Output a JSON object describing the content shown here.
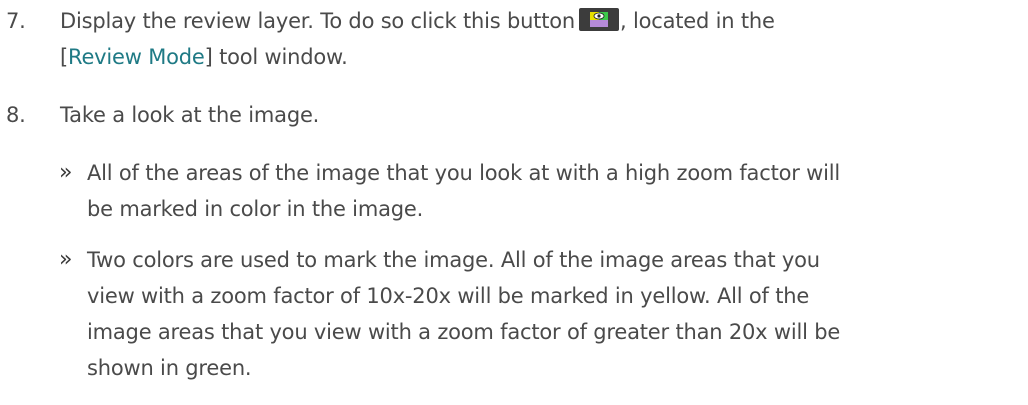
{
  "step7": {
    "number": "7.",
    "line1_before": "Display the review layer. To do so click this button",
    "button_icon": "review-layer-icon",
    "line1_after": ", located in the",
    "line2_open": "[",
    "line2_link": "Review Mode",
    "line2_close": "] tool window."
  },
  "step8": {
    "number": "8.",
    "text": "Take a look at the image."
  },
  "bullets": [
    {
      "mark": "»",
      "lines": [
        "All of the areas of the image that you look at with a high zoom factor will",
        "be marked in color in the image."
      ]
    },
    {
      "mark": "»",
      "lines": [
        "Two colors are used to mark the image. All of the image areas that you",
        "view with a zoom factor of 10x-20x will be marked in yellow. All of the",
        "image areas that you view with a zoom factor of greater than 20x will be",
        "shown in green."
      ]
    }
  ],
  "colors": {
    "text": "#4a4a4a",
    "link": "#1f7a85",
    "button_bg": "#3c3c3c",
    "icon_yellow": "#e8e000",
    "icon_green": "#3cc84a",
    "icon_purple": "#b58ad8"
  }
}
